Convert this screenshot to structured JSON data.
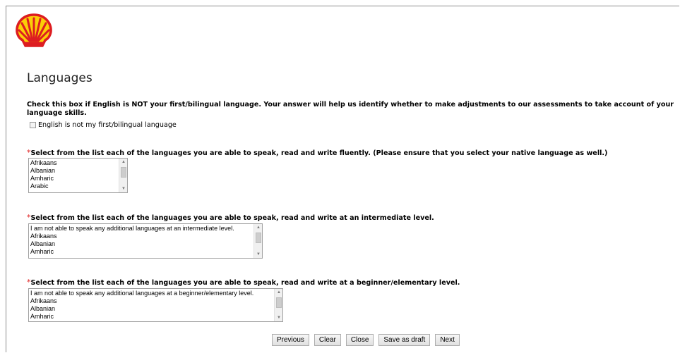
{
  "brand": {
    "logo": "shell-pecten-logo",
    "colors": {
      "red": "#dd1d21",
      "yellow": "#fbce07"
    }
  },
  "page": {
    "title": "Languages"
  },
  "intro": {
    "text": "Check this box if English is NOT your first/bilingual language. Your answer will help us identify whether to make adjustments to our assessments to take account of your language skills."
  },
  "english_checkbox": {
    "label": "English is not my first/bilingual language",
    "checked": false
  },
  "questions": [
    {
      "required_mark": "*",
      "label": "Select from the list each of the languages you are able to speak, read and write fluently. (Please ensure that you select your native language as well.)",
      "options": [
        "Afrikaans",
        "Albanian",
        "Amharic",
        "Arabic"
      ]
    },
    {
      "required_mark": "*",
      "label": "Select from the list each of the languages you are able to speak, read and write at an intermediate level.",
      "options": [
        "I am not able to speak any additional languages at an intermediate level.",
        "Afrikaans",
        "Albanian",
        "Amharic"
      ]
    },
    {
      "required_mark": "*",
      "label": "Select from the list each of the languages you are able to speak, read and write at a beginner/elementary level.",
      "options": [
        "I am not able to speak any additional languages at a beginner/elementary level.",
        "Afrikaans",
        "Albanian",
        "Amharic"
      ]
    }
  ],
  "buttons": {
    "previous": "Previous",
    "clear": "Clear",
    "close": "Close",
    "save_draft": "Save as draft",
    "next": "Next"
  }
}
